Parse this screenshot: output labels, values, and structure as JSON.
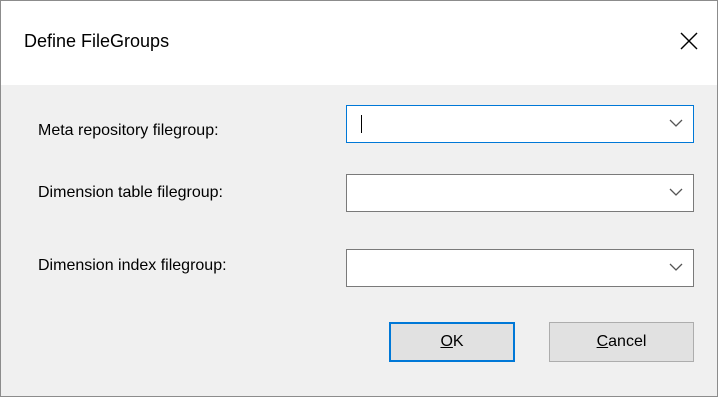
{
  "window": {
    "title": "Define FileGroups",
    "close_icon": "close-icon"
  },
  "fields": [
    {
      "label": "Meta repository filegroup:",
      "value": ""
    },
    {
      "label": "Dimension table filegroup:",
      "value": ""
    },
    {
      "label": "Dimension index filegroup:",
      "value": ""
    }
  ],
  "buttons": {
    "ok": {
      "accel": "O",
      "rest": "K"
    },
    "cancel": {
      "accel": "C",
      "rest": "ancel"
    }
  },
  "colors": {
    "accent": "#0078d7",
    "dialog_bg": "#f0f0f0",
    "button_bg": "#e1e1e1"
  }
}
